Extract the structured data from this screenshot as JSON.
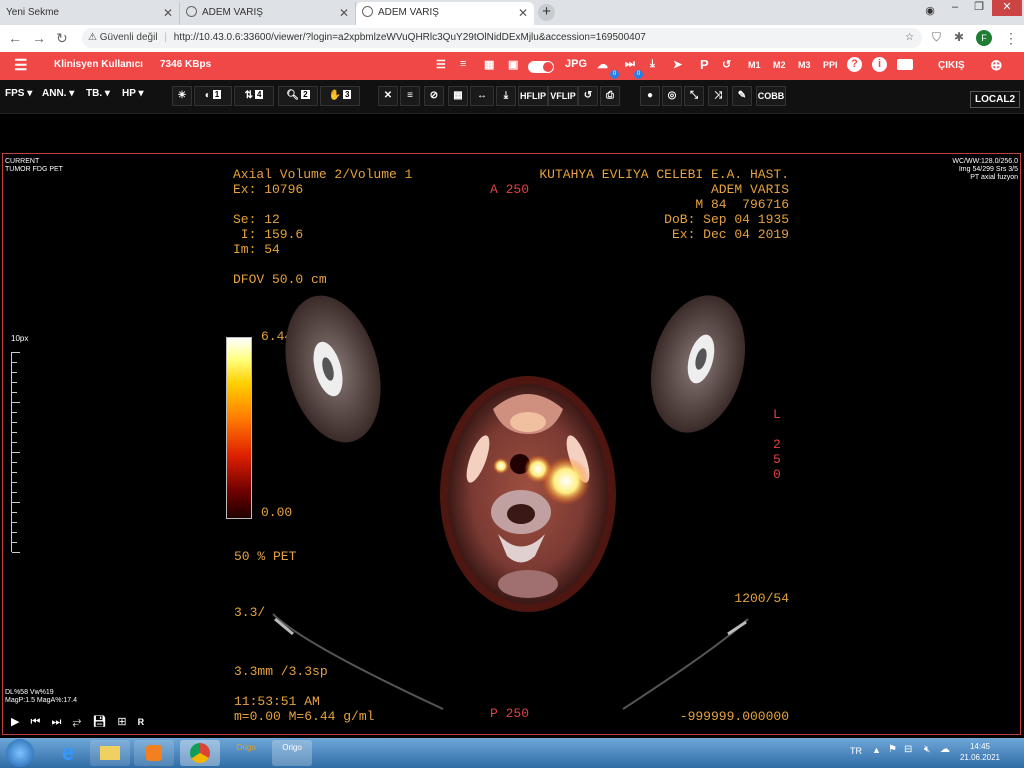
{
  "browser": {
    "tabs": [
      {
        "label": "Yeni Sekme",
        "active": false
      },
      {
        "label": "ADEM VARIŞ",
        "active": false
      },
      {
        "label": "ADEM VARIŞ",
        "active": true
      }
    ],
    "new_tab": "+",
    "security_label": "Güvenli değil",
    "url": "http://10.43.0.6:33600/viewer/?login=a2xpbmlzeWVuQHRlc3QuY29tOlNidDExMjlu&accession=169500407",
    "profile_initial": "F"
  },
  "app": {
    "user_label": "Klinisyen Kullanıcı",
    "speed": "7346 KBps",
    "header_icons": [
      "list-icon",
      "text-icon",
      "grid-icon",
      "image-icon",
      "toggle",
      "JPG",
      "cloud-download-icon",
      "step-icon",
      "download-icon",
      "send-icon",
      "P",
      "history-icon",
      "M1",
      "M2",
      "M3",
      "PPI",
      "help-icon",
      "info-icon",
      "tag-icon"
    ],
    "jpg": "JPG",
    "p": "P",
    "m1": "M1",
    "m2": "M2",
    "m3": "M3",
    "ppi": "PPI",
    "badge": "0",
    "logout": "ÇIKIŞ",
    "menus": {
      "fps": "FPS",
      "ann": "ANN.",
      "tb": "TB.",
      "hp": "HP"
    },
    "tool_numbers": {
      "one": "1",
      "four": "4",
      "two": "2",
      "three": "3"
    },
    "hflip": "HFLIP",
    "vflip": "VFLIP",
    "cobb": "COBB",
    "local": "LOCAL2"
  },
  "viewer": {
    "corner_tl": "CURRENT\nTUMOR FDG PET",
    "corner_tr": "WC/WW:128.0/256.0\nImg 54/299 Srs 3/5\nPT axial fuzyon",
    "ruler_label": "10px",
    "bottom_left_info": "DL%58 Vw%19\nMagP:1.5 MagA%:17.4",
    "playback_r": "R",
    "overlay_tl": "Axial Volume 2/Volume 1\nEx: 10796\n\nSe: 12\n I: 159.6\nIm: 54\n\nDFOV 50.0 cm",
    "overlay_a": "A 250",
    "overlay_tr": "KUTAHYA EVLIYA CELEBI E.A. HAST.\nADEM VARIS\nM 84  796716\nDoB: Sep 04 1935\nEx: Dec 04 2019",
    "scale_max": "6.44",
    "scale_min": "0.00",
    "overlay_L": "L\n\n2\n5\n0",
    "pet_percent": "50 % PET",
    "overlay_br_top": "1200/54",
    "overlay_bl_1": "3.3/",
    "overlay_bl_2": "3.3mm /3.3sp",
    "time": "11:53:51 AM",
    "mm": "m=0.00 M=6.44 g/ml",
    "overlay_p": "P 250",
    "overlay_br": "-999999.000000"
  },
  "taskbar": {
    "apps": [
      "start",
      "ie",
      "explorer",
      "media",
      "chrome",
      "Origo",
      "Origo"
    ],
    "origo1": "Origo",
    "origo2": "Origo",
    "lang": "TR",
    "time": "14:45",
    "date": "21.06.2021"
  }
}
